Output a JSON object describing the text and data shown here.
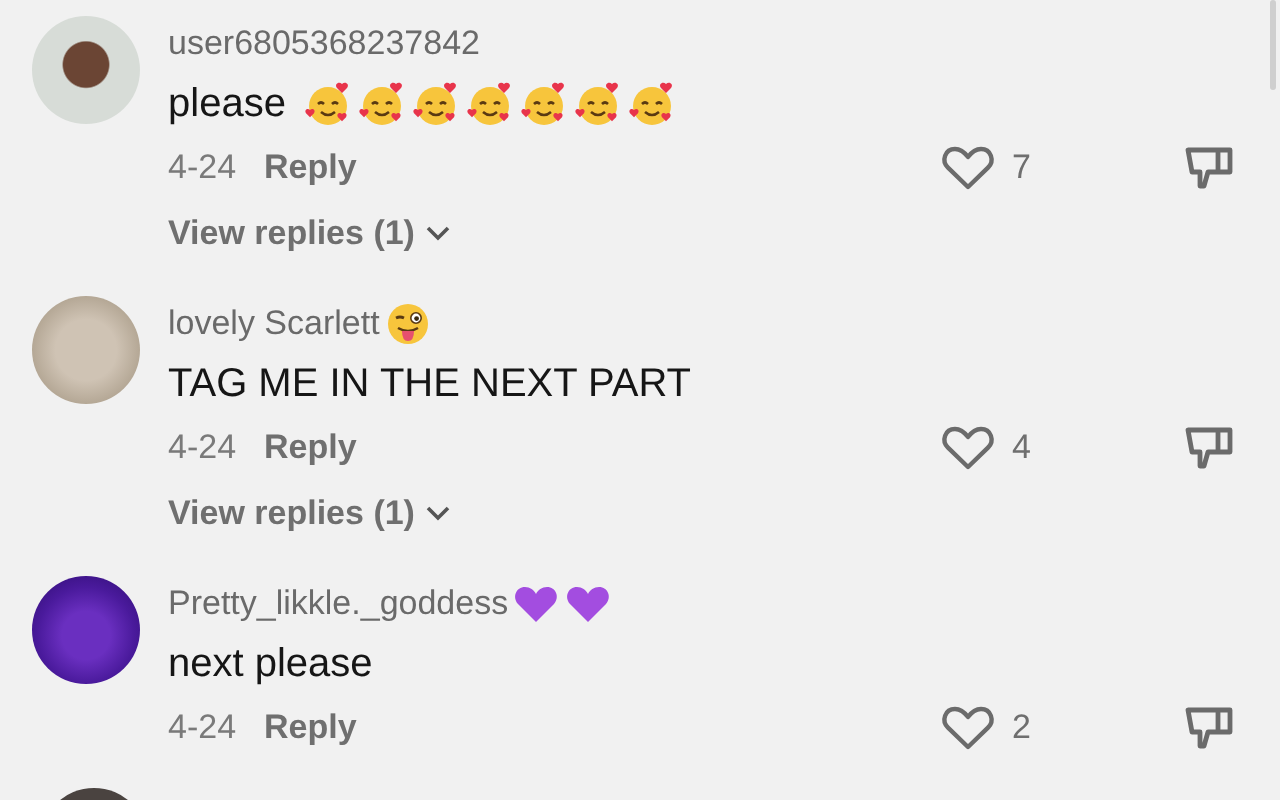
{
  "comments": [
    {
      "username": "user6805368237842",
      "text": "please",
      "text_emojis": [
        {
          "kind": "smiling-hearts"
        },
        {
          "kind": "smiling-hearts"
        },
        {
          "kind": "smiling-hearts"
        },
        {
          "kind": "smiling-hearts"
        },
        {
          "kind": "smiling-hearts"
        },
        {
          "kind": "smiling-hearts"
        },
        {
          "kind": "smiling-hearts"
        }
      ],
      "date": "4-24",
      "reply": "Reply",
      "likes": "7",
      "view_replies": "View replies (1)"
    },
    {
      "username": "lovely Scarlett",
      "name_emojis": [
        {
          "kind": "winking-tongue"
        }
      ],
      "text": "TAG ME IN THE NEXT PART",
      "date": "4-24",
      "reply": "Reply",
      "likes": "4",
      "view_replies": "View replies (1)"
    },
    {
      "username": "Pretty_likkle._goddess",
      "name_emojis": [
        {
          "kind": "purple-heart"
        },
        {
          "kind": "purple-heart"
        }
      ],
      "text": "next please",
      "date": "4-24",
      "reply": "Reply",
      "likes": "2"
    }
  ]
}
